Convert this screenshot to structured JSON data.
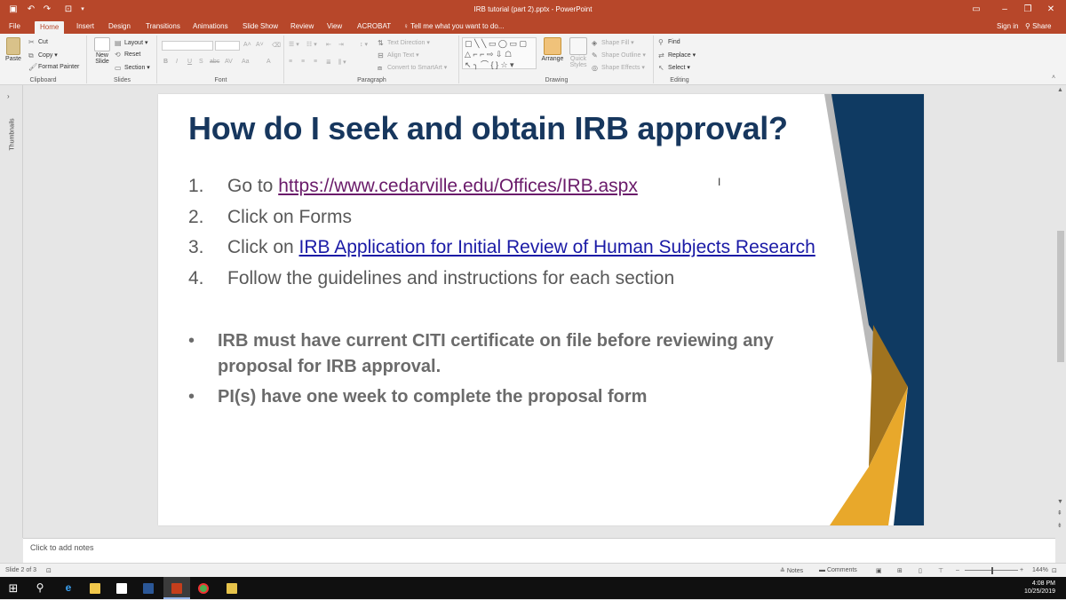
{
  "window": {
    "title": "IRB tutorial  (part 2).pptx - PowerPoint",
    "save_icon": "save-icon",
    "undo_icon": "undo-icon",
    "redo_icon": "redo-icon"
  },
  "tabs": [
    "File",
    "Home",
    "Insert",
    "Design",
    "Transitions",
    "Animations",
    "Slide Show",
    "Review",
    "View",
    "ACROBAT"
  ],
  "active_tab": "Home",
  "tell_me": "Tell me what you want to do...",
  "sign_in": "Sign in",
  "share": "Share",
  "ribbon": {
    "clipboard": {
      "label": "Clipboard",
      "paste": "Paste",
      "cut": "Cut",
      "copy": "Copy",
      "format_painter": "Format Painter"
    },
    "slides": {
      "label": "Slides",
      "new_slide": "New Slide",
      "layout": "Layout",
      "reset": "Reset",
      "section": "Section"
    },
    "font": {
      "label": "Font",
      "bold": "B",
      "italic": "I",
      "underline": "U",
      "strike": "S",
      "abc": "abc",
      "av": "AV",
      "aa": "Aa",
      "a_color": "A"
    },
    "paragraph": {
      "label": "Paragraph",
      "text_direction": "Text Direction",
      "align_text": "Align Text",
      "convert_smartart": "Convert to SmartArt"
    },
    "drawing": {
      "label": "Drawing",
      "arrange": "Arrange",
      "quick_styles": "Quick Styles",
      "shape_fill": "Shape Fill",
      "shape_outline": "Shape Outline",
      "shape_effects": "Shape Effects"
    },
    "editing": {
      "label": "Editing",
      "find": "Find",
      "replace": "Replace",
      "select": "Select"
    }
  },
  "thumbnails_label": "Thumbnails",
  "slide": {
    "title": "How do I seek and obtain IRB approval?",
    "steps": [
      {
        "num": "1.",
        "text": "Go to ",
        "link": "https://www.cedarville.edu/Offices/IRB.aspx"
      },
      {
        "num": "2.",
        "text": "Click on Forms"
      },
      {
        "num": "3.",
        "text": "Click on ",
        "link": "IRB Application for Initial Review of Human Subjects Research"
      },
      {
        "num": "4.",
        "text": "Follow the guidelines and instructions for each section"
      }
    ],
    "bullets": [
      "IRB must have current CITI certificate on file before reviewing any proposal for IRB approval.",
      "PI(s) have one week to complete the proposal form"
    ],
    "colors": {
      "title": "#17375e",
      "navy": "#0f3a62",
      "gold": "#e8a82b",
      "gray_band": "#b9b9b9"
    }
  },
  "notes_placeholder": "Click to add notes",
  "status": {
    "slide_of": "Slide 2 of 3",
    "notes": "Notes",
    "comments": "Comments",
    "zoom": "144%"
  },
  "taskbar": {
    "time": "4:08 PM",
    "date": "10/25/2019"
  }
}
